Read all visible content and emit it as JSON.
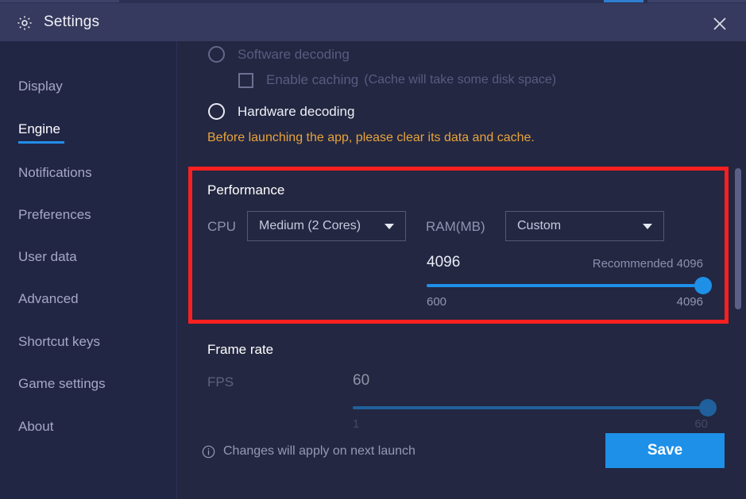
{
  "window": {
    "title": "Settings",
    "gear_icon": "gear-icon",
    "close_icon": "close-icon"
  },
  "sidebar": {
    "items": [
      {
        "label": "Display",
        "active": false
      },
      {
        "label": "Engine",
        "active": true
      },
      {
        "label": "Notifications",
        "active": false
      },
      {
        "label": "Preferences",
        "active": false
      },
      {
        "label": "User data",
        "active": false
      },
      {
        "label": "Advanced",
        "active": false
      },
      {
        "label": "Shortcut keys",
        "active": false
      },
      {
        "label": "Game settings",
        "active": false
      },
      {
        "label": "About",
        "active": false
      }
    ]
  },
  "decoding": {
    "software_label": "Software decoding",
    "software_selected": false,
    "caching_label": "Enable caching",
    "caching_hint": "(Cache will take some disk space)",
    "caching_checked": false,
    "hardware_label": "Hardware decoding",
    "hardware_selected": true,
    "warning": "Before launching the app, please clear its data and cache."
  },
  "performance": {
    "title": "Performance",
    "cpu_label": "CPU",
    "cpu_value": "Medium (2 Cores)",
    "ram_label": "RAM(MB)",
    "ram_mode": "Custom",
    "ram_value": "4096",
    "ram_recommended": "Recommended 4096",
    "ram_min": "600",
    "ram_max": "4096",
    "ram_percent": 100
  },
  "frame_rate": {
    "title": "Frame rate",
    "fps_label": "FPS",
    "fps_value": "60",
    "fps_min": "1",
    "fps_max": "60",
    "fps_percent": 100
  },
  "footer": {
    "note": "Changes will apply on next launch",
    "info_icon": "info-circle-icon",
    "save_label": "Save"
  },
  "colors": {
    "accent": "#1e90e8",
    "highlight_box": "#fa2020",
    "warning": "#e8a33c",
    "titlebar_bg": "#363a5e",
    "sidebar_bg": "#222645",
    "content_bg": "#232741"
  }
}
